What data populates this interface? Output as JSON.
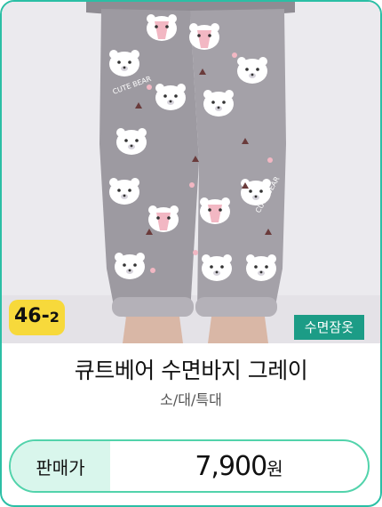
{
  "product": {
    "code_main": "46-",
    "code_sub": "2",
    "category": "수면잠옷",
    "title": "큐트베어 수면바지 그레이",
    "sizes": "소/대/특대",
    "price_label": "판매가",
    "price": "7,900",
    "currency": "원"
  },
  "colors": {
    "accent": "#2bbfa5",
    "category_badge": "#1c9c86",
    "code_badge": "#f7d93b",
    "price_label_bg": "#d9f6ec",
    "pants_gray": "#9d9aa1"
  },
  "image": {
    "print_text_1": "CUTE BEAR",
    "print_text_2": "CUTE BEAR"
  }
}
